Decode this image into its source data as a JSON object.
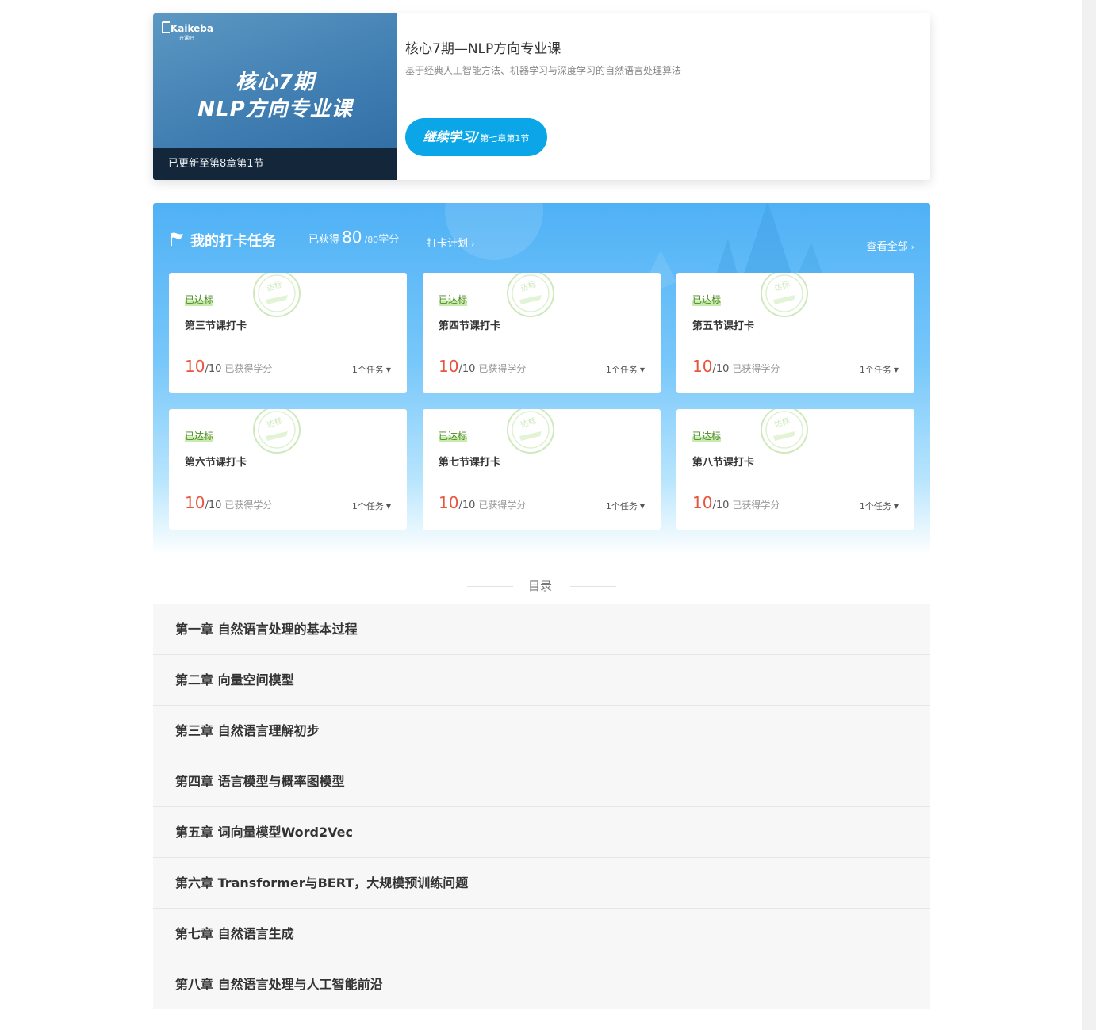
{
  "course": {
    "brand": "Kaikeba",
    "brand_sub": "开课吧",
    "cover_title_line1": "核心7期",
    "cover_title_line2": "NLP方向专业课",
    "update_status": "已更新至第8章第1节",
    "name": "核心7期—NLP方向专业课",
    "description": "基于经典人工智能方法、机器学习与深度学习的自然语言处理算法",
    "continue_label": "继续学习/",
    "continue_progress": "第七章第1节",
    "accent_color": "#0aa6e8"
  },
  "checkin": {
    "title": "我的打卡任务",
    "score_prefix": "已获得",
    "score_earned": "80",
    "score_sep": "/",
    "score_total": "80",
    "score_unit": "学分",
    "plan_link": "打卡计划",
    "view_all": "查看全部",
    "tasks": [
      {
        "status": "已达标",
        "name": "第三节课打卡",
        "earned": "10",
        "total": "/10",
        "score_label": "已获得学分",
        "count": "1个任务",
        "stamp": "达标"
      },
      {
        "status": "已达标",
        "name": "第四节课打卡",
        "earned": "10",
        "total": "/10",
        "score_label": "已获得学分",
        "count": "1个任务",
        "stamp": "达标"
      },
      {
        "status": "已达标",
        "name": "第五节课打卡",
        "earned": "10",
        "total": "/10",
        "score_label": "已获得学分",
        "count": "1个任务",
        "stamp": "达标"
      },
      {
        "status": "已达标",
        "name": "第六节课打卡",
        "earned": "10",
        "total": "/10",
        "score_label": "已获得学分",
        "count": "1个任务",
        "stamp": "达标"
      },
      {
        "status": "已达标",
        "name": "第七节课打卡",
        "earned": "10",
        "total": "/10",
        "score_label": "已获得学分",
        "count": "1个任务",
        "stamp": "达标"
      },
      {
        "status": "已达标",
        "name": "第八节课打卡",
        "earned": "10",
        "total": "/10",
        "score_label": "已获得学分",
        "count": "1个任务",
        "stamp": "达标"
      }
    ]
  },
  "toc": {
    "title": "目录",
    "chapters": [
      "第一章 自然语言处理的基本过程",
      "第二章 向量空间模型",
      "第三章 自然语言理解初步",
      "第四章 语言模型与概率图模型",
      "第五章 词向量模型Word2Vec",
      "第六章 Transformer与BERT，大规模预训练问题",
      "第七章 自然语言生成",
      "第八章 自然语言处理与人工智能前沿"
    ]
  }
}
